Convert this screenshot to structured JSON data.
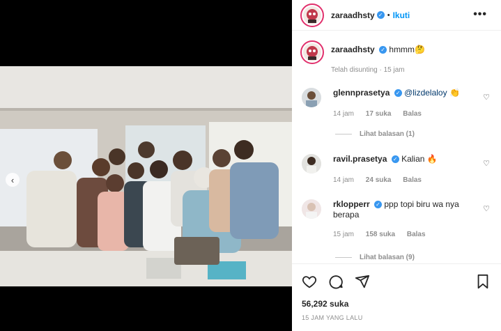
{
  "header": {
    "username": "zaraadhsty",
    "follow_label": "Ikuti",
    "dot": "•",
    "more": "•••"
  },
  "caption": {
    "username": "zaraadhsty",
    "text": "hmmm🤔",
    "edited": "Telah disunting",
    "time": "15 jam"
  },
  "comments": [
    {
      "username": "glennprasetya",
      "mention": "@lizdelaloy",
      "text": " 👏",
      "time": "14 jam",
      "likes": "17 suka",
      "reply": "Balas",
      "view_replies": "Lihat balasan (1)"
    },
    {
      "username": "ravil.prasetya",
      "text": "Kalian 🔥",
      "time": "14 jam",
      "likes": "24 suka",
      "reply": "Balas"
    },
    {
      "username": "rklopperr",
      "text": "ppp topi biru wa nya berapa",
      "time": "15 jam",
      "likes": "158 suka",
      "reply": "Balas",
      "view_replies": "Lihat balasan (9)"
    }
  ],
  "actions": {
    "likes": "56,292 suka",
    "timestamp": "15 JAM YANG LALU"
  },
  "icons": [
    "heart-icon",
    "comment-icon",
    "share-icon",
    "bookmark-icon",
    "chevron-left-icon"
  ],
  "colors": {
    "verified": "#3897f0",
    "follow": "#0095f6",
    "story_ring": "#e1306c"
  }
}
